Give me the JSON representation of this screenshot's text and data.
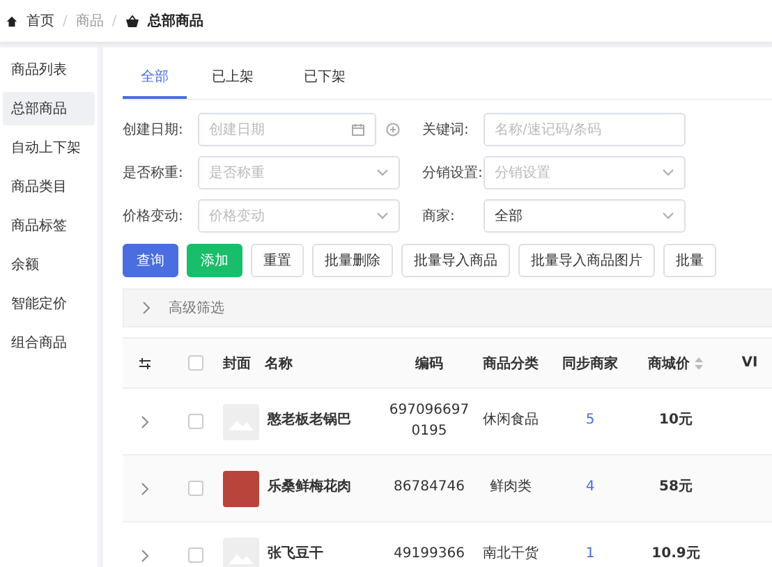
{
  "breadcrumb": [
    {
      "label": "首页",
      "kind": "home",
      "separator": "/"
    },
    {
      "label": "商品",
      "kind": "plain",
      "separator": "/"
    },
    {
      "label": "总部商品",
      "kind": "current"
    }
  ],
  "sidebar": {
    "items": [
      {
        "label": "商品列表",
        "selected": false
      },
      {
        "label": "总部商品",
        "selected": true
      },
      {
        "label": "自动上下架",
        "selected": false
      },
      {
        "label": "商品类目",
        "selected": false
      },
      {
        "label": "商品标签",
        "selected": false
      },
      {
        "label": "余额",
        "selected": false
      },
      {
        "label": "智能定价",
        "selected": false
      },
      {
        "label": "组合商品",
        "selected": false
      }
    ]
  },
  "tabs": [
    {
      "label": "全部",
      "selected": true
    },
    {
      "label": "已上架",
      "selected": false
    },
    {
      "label": "已下架",
      "selected": false
    }
  ],
  "filters": [
    {
      "label": "创建日期:",
      "kind": "date",
      "placeholder": "创建日期"
    },
    {
      "label": "关键词:",
      "kind": "text",
      "placeholder": "名称/速记码/条码"
    },
    {
      "label": "是否称重:",
      "kind": "select",
      "placeholder": "是否称重"
    },
    {
      "label": "分销设置:",
      "kind": "select",
      "placeholder": "分销设置"
    },
    {
      "label": "价格变动:",
      "kind": "select",
      "placeholder": "价格变动"
    },
    {
      "label": "商家:",
      "kind": "select",
      "value": "全部"
    }
  ],
  "buttons": [
    {
      "label": "查询",
      "kind": "primary"
    },
    {
      "label": "添加",
      "kind": "success"
    },
    {
      "label": "重置",
      "kind": "default"
    },
    {
      "label": "批量删除",
      "kind": "default"
    },
    {
      "label": "批量导入商品",
      "kind": "default"
    },
    {
      "label": "批量导入商品图片",
      "kind": "default"
    },
    {
      "label": "批量",
      "kind": "default"
    }
  ],
  "advanced_filter": {
    "label": "高级筛选",
    "expanded": false
  },
  "table": {
    "all_checked": false,
    "columns": [
      "封面",
      "名称",
      "编码",
      "商品分类",
      "同步商家",
      "商城价",
      "VI"
    ],
    "rows": [
      {
        "name": "憨老板老锅巴",
        "code": "6970966970195",
        "category": "休闲食品",
        "merchants": "5",
        "price": "10元",
        "photo": false,
        "checked": false
      },
      {
        "name": "乐桑鲜梅花肉",
        "code": "86784746",
        "category": "鲜肉类",
        "merchants": "4",
        "price": "58元",
        "photo": true,
        "checked": false
      },
      {
        "name": "张飞豆干",
        "code": "49199366",
        "category": "南北干货",
        "merchants": "1",
        "price": "10.9元",
        "photo": false,
        "checked": false
      }
    ]
  }
}
